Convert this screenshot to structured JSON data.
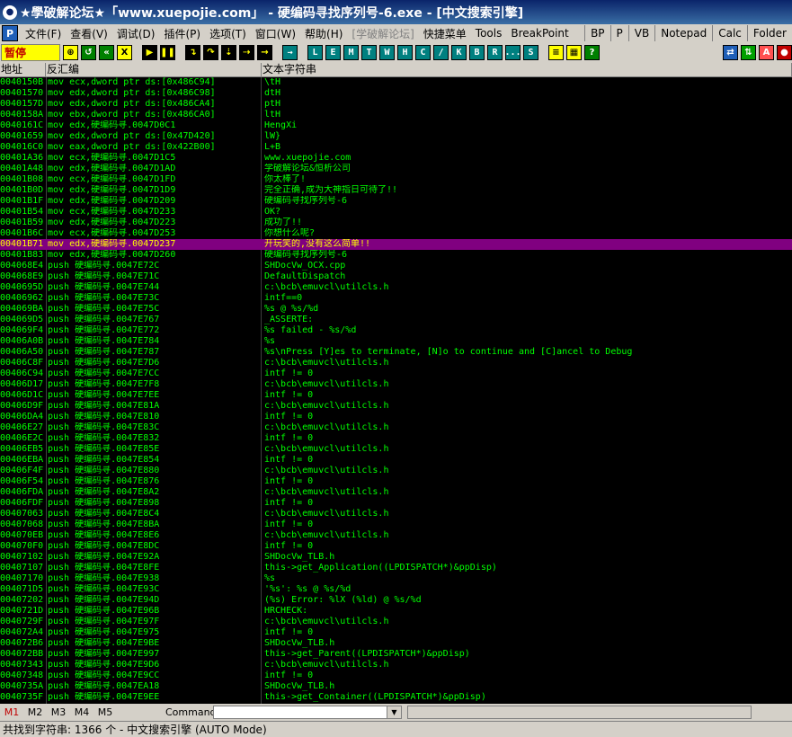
{
  "window": {
    "title": "★學破解论坛★「www.xuepojie.com」 - 硬编码寻找序列号-6.exe - [中文搜索引擎]"
  },
  "menu": {
    "p_button": "P",
    "items": [
      "文件(F)",
      "查看(V)",
      "调试(D)",
      "插件(P)",
      "选项(T)",
      "窗口(W)",
      "帮助(H)",
      "[学破解论坛]",
      "快捷菜单",
      "Tools",
      "BreakPoint"
    ],
    "quick": [
      "BP",
      "P",
      "VB",
      "Notepad",
      "Calc",
      "Folder"
    ]
  },
  "toolbar": {
    "status": "暂停",
    "letters": [
      "L",
      "E",
      "M",
      "T",
      "W",
      "H",
      "C",
      "/",
      "K",
      "B",
      "R",
      "...",
      "S"
    ]
  },
  "columns": {
    "address": "地址",
    "disasm": "反汇编",
    "text": "文本字符串"
  },
  "rows": [
    {
      "addr": "0040150B",
      "asm": "mov ecx,dword ptr ds:[0x486C94]",
      "str": "\\tH"
    },
    {
      "addr": "00401570",
      "asm": "mov edx,dword ptr ds:[0x486C98]",
      "str": "dtH"
    },
    {
      "addr": "0040157D",
      "asm": "mov edx,dword ptr ds:[0x486CA4]",
      "str": "ptH"
    },
    {
      "addr": "0040158A",
      "asm": "mov ebx,dword ptr ds:[0x486CA0]",
      "str": "ltH"
    },
    {
      "addr": "0040161C",
      "asm": "mov edx,硬编码寻.0047D0C1",
      "str": "HengXi"
    },
    {
      "addr": "00401659",
      "asm": "mov edx,dword ptr ds:[0x47D420]",
      "str": "lW}"
    },
    {
      "addr": "004016C0",
      "asm": "mov eax,dword ptr ds:[0x422B00]",
      "str": "L+B"
    },
    {
      "addr": "00401A36",
      "asm": "mov ecx,硬编码寻.0047D1C5",
      "str": "www.xuepojie.com"
    },
    {
      "addr": "00401A48",
      "asm": "mov edx,硬编码寻.0047D1AD",
      "str": "学破解论坛&恒析公司"
    },
    {
      "addr": "00401B08",
      "asm": "mov ecx,硬编码寻.0047D1FD",
      "str": "你太棒了!"
    },
    {
      "addr": "00401B0D",
      "asm": "mov edx,硬编码寻.0047D1D9",
      "str": "完全正确,成为大神指日可待了!!"
    },
    {
      "addr": "00401B1F",
      "asm": "mov edx,硬编码寻.0047D209",
      "str": "硬编码寻找序列号-6"
    },
    {
      "addr": "00401B54",
      "asm": "mov ecx,硬编码寻.0047D233",
      "str": "OK?"
    },
    {
      "addr": "00401B59",
      "asm": "mov edx,硬编码寻.0047D223",
      "str": "成功了!!"
    },
    {
      "addr": "00401B6C",
      "asm": "mov ecx,硬编码寻.0047D253",
      "str": "你想什么呢?"
    },
    {
      "addr": "00401B71",
      "asm": "mov edx,硬编码寻.0047D237",
      "str": "开玩笑的,没有这么简单!!",
      "selected": true
    },
    {
      "addr": "00401B83",
      "asm": "mov edx,硬编码寻.0047D260",
      "str": "硬编码寻找序列号-6"
    },
    {
      "addr": "004068E4",
      "asm": "push 硬编码寻.0047E72C",
      "str": "SHDocVw_OCX.cpp"
    },
    {
      "addr": "004068E9",
      "asm": "push 硬编码寻.0047E71C",
      "str": "DefaultDispatch"
    },
    {
      "addr": "0040695D",
      "asm": "push 硬编码寻.0047E744",
      "str": "c:\\bcb\\emuvcl\\utilcls.h"
    },
    {
      "addr": "00406962",
      "asm": "push 硬编码寻.0047E73C",
      "str": "intf==0"
    },
    {
      "addr": "004069BA",
      "asm": "push 硬编码寻.0047E75C",
      "str": "%s @ %s/%d"
    },
    {
      "addr": "004069D5",
      "asm": "push 硬编码寻.0047E767",
      "str": "_ASSERTE:"
    },
    {
      "addr": "004069F4",
      "asm": "push 硬编码寻.0047E772",
      "str": "%s failed - %s/%d"
    },
    {
      "addr": "00406A0B",
      "asm": "push 硬编码寻.0047E784",
      "str": "%s"
    },
    {
      "addr": "00406A50",
      "asm": "push 硬编码寻.0047E787",
      "str": "%s\\nPress [Y]es to terminate, [N]o to continue and [C]ancel to Debug"
    },
    {
      "addr": "00406C8F",
      "asm": "push 硬编码寻.0047E7D6",
      "str": "c:\\bcb\\emuvcl\\utilcls.h"
    },
    {
      "addr": "00406C94",
      "asm": "push 硬编码寻.0047E7CC",
      "str": "intf != 0"
    },
    {
      "addr": "00406D17",
      "asm": "push 硬编码寻.0047E7F8",
      "str": "c:\\bcb\\emuvcl\\utilcls.h"
    },
    {
      "addr": "00406D1C",
      "asm": "push 硬编码寻.0047E7EE",
      "str": "intf != 0"
    },
    {
      "addr": "00406D9F",
      "asm": "push 硬编码寻.0047E81A",
      "str": "c:\\bcb\\emuvcl\\utilcls.h"
    },
    {
      "addr": "00406DA4",
      "asm": "push 硬编码寻.0047E810",
      "str": "intf != 0"
    },
    {
      "addr": "00406E27",
      "asm": "push 硬编码寻.0047E83C",
      "str": "c:\\bcb\\emuvcl\\utilcls.h"
    },
    {
      "addr": "00406E2C",
      "asm": "push 硬编码寻.0047E832",
      "str": "intf != 0"
    },
    {
      "addr": "00406EB5",
      "asm": "push 硬编码寻.0047E85E",
      "str": "c:\\bcb\\emuvcl\\utilcls.h"
    },
    {
      "addr": "00406EBA",
      "asm": "push 硬编码寻.0047E854",
      "str": "intf != 0"
    },
    {
      "addr": "00406F4F",
      "asm": "push 硬编码寻.0047E880",
      "str": "c:\\bcb\\emuvcl\\utilcls.h"
    },
    {
      "addr": "00406F54",
      "asm": "push 硬编码寻.0047E876",
      "str": "intf != 0"
    },
    {
      "addr": "00406FDA",
      "asm": "push 硬编码寻.0047E8A2",
      "str": "c:\\bcb\\emuvcl\\utilcls.h"
    },
    {
      "addr": "00406FDF",
      "asm": "push 硬编码寻.0047E898",
      "str": "intf != 0"
    },
    {
      "addr": "00407063",
      "asm": "push 硬编码寻.0047E8C4",
      "str": "c:\\bcb\\emuvcl\\utilcls.h"
    },
    {
      "addr": "00407068",
      "asm": "push 硬编码寻.0047E8BA",
      "str": "intf != 0"
    },
    {
      "addr": "004070EB",
      "asm": "push 硬编码寻.0047E8E6",
      "str": "c:\\bcb\\emuvcl\\utilcls.h"
    },
    {
      "addr": "004070F0",
      "asm": "push 硬编码寻.0047E8DC",
      "str": "intf != 0"
    },
    {
      "addr": "00407102",
      "asm": "push 硬编码寻.0047E92A",
      "str": "SHDocVw_TLB.h"
    },
    {
      "addr": "00407107",
      "asm": "push 硬编码寻.0047E8FE",
      "str": "this->get_Application((LPDISPATCH*)&ppDisp)"
    },
    {
      "addr": "00407170",
      "asm": "push 硬编码寻.0047E938",
      "str": "%s"
    },
    {
      "addr": "004071D5",
      "asm": "push 硬编码寻.0047E93C",
      "str": "'%s': %s @ %s/%d"
    },
    {
      "addr": "00407202",
      "asm": "push 硬编码寻.0047E94D",
      "str": "(%s) Error: %lX (%ld) @ %s/%d"
    },
    {
      "addr": "0040721D",
      "asm": "push 硬编码寻.0047E96B",
      "str": "HRCHECK:"
    },
    {
      "addr": "0040729F",
      "asm": "push 硬编码寻.0047E97F",
      "str": "c:\\bcb\\emuvcl\\utilcls.h"
    },
    {
      "addr": "004072A4",
      "asm": "push 硬编码寻.0047E975",
      "str": "intf != 0"
    },
    {
      "addr": "004072B6",
      "asm": "push 硬编码寻.0047E9BE",
      "str": "SHDocVw_TLB.h"
    },
    {
      "addr": "004072BB",
      "asm": "push 硬编码寻.0047E997",
      "str": "this->get_Parent((LPDISPATCH*)&ppDisp)"
    },
    {
      "addr": "00407343",
      "asm": "push 硬编码寻.0047E9D6",
      "str": "c:\\bcb\\emuvcl\\utilcls.h"
    },
    {
      "addr": "00407348",
      "asm": "push 硬编码寻.0047E9CC",
      "str": "intf != 0"
    },
    {
      "addr": "0040735A",
      "asm": "push 硬编码寻.0047EA18",
      "str": "SHDocVw_TLB.h"
    },
    {
      "addr": "0040735F",
      "asm": "push 硬编码寻.0047E9EE",
      "str": "this->get_Container((LPDISPATCH*)&ppDisp)"
    }
  ],
  "command": {
    "tabs": [
      "M1",
      "M2",
      "M3",
      "M4",
      "M5"
    ],
    "label": "Command:"
  },
  "status": {
    "text": "共找到字符串: 1366 个  -  中文搜索引擎 (AUTO Mode)"
  }
}
